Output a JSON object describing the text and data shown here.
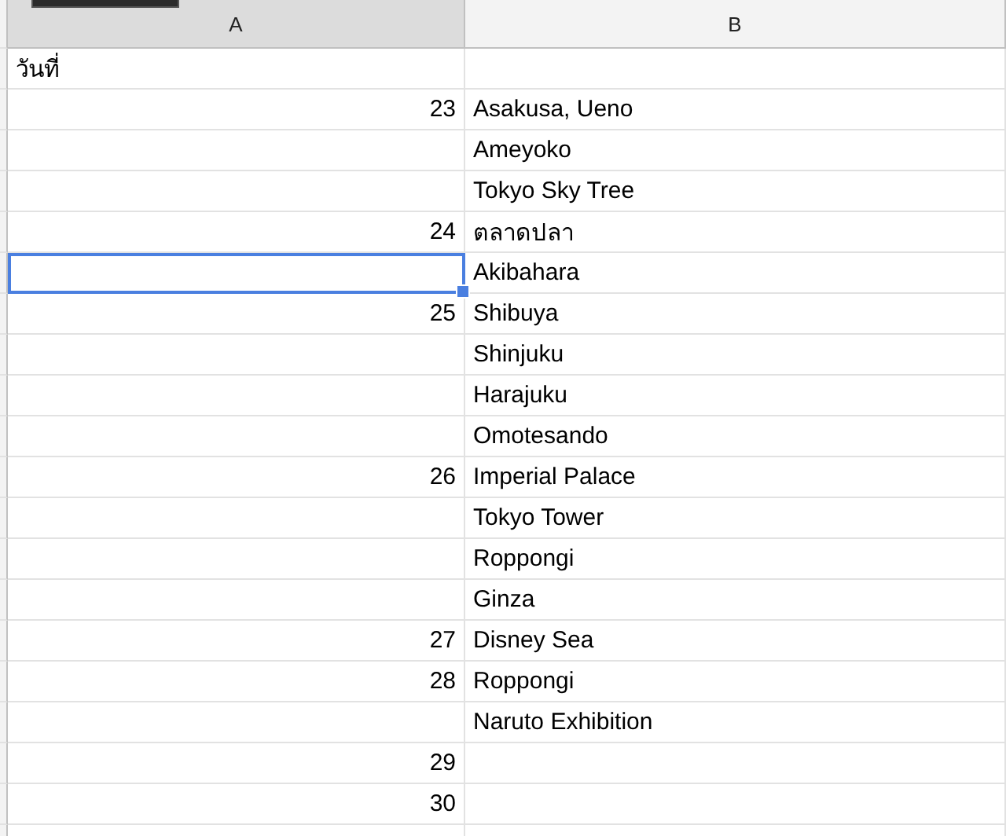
{
  "columns": [
    "A",
    "B"
  ],
  "rows": [
    {
      "a": "วันที่",
      "selected": false
    },
    {
      "a": "23",
      "b": "Asakusa, Ueno",
      "selected": false
    },
    {
      "b": "Ameyoko",
      "selected": false
    },
    {
      "b": "Tokyo Sky Tree",
      "selected": false
    },
    {
      "a": "24",
      "b": "ตลาดปลา",
      "selected": false
    },
    {
      "b": "Akibahara",
      "selected": true
    },
    {
      "a": "25",
      "b": "Shibuya",
      "selected": false
    },
    {
      "b": "Shinjuku",
      "selected": false
    },
    {
      "b": "Harajuku",
      "selected": false
    },
    {
      "b": "Omotesando",
      "selected": false
    },
    {
      "a": "26",
      "b": "Imperial Palace",
      "selected": false
    },
    {
      "b": "Tokyo Tower",
      "selected": false
    },
    {
      "b": "Roppongi",
      "selected": false
    },
    {
      "b": "Ginza",
      "selected": false
    },
    {
      "a": "27",
      "b": "Disney Sea",
      "selected": false
    },
    {
      "a": "28",
      "b": "Roppongi",
      "selected": false
    },
    {
      "b": "Naruto Exhibition",
      "selected": false
    },
    {
      "a": "29",
      "selected": false
    },
    {
      "a": "30",
      "selected": false
    },
    {
      "selected": false
    }
  ]
}
